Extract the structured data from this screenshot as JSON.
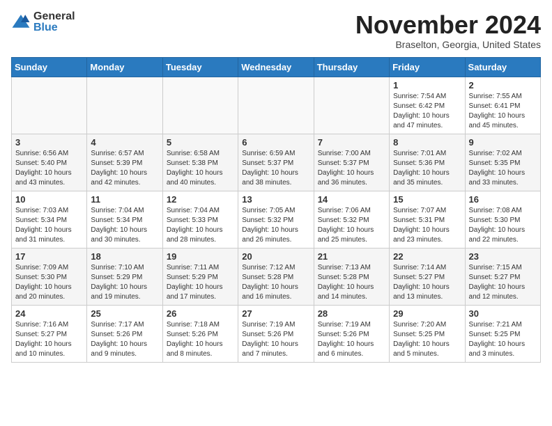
{
  "logo": {
    "general": "General",
    "blue": "Blue",
    "arrow_color": "#2a7abf"
  },
  "title": "November 2024",
  "location": "Braselton, Georgia, United States",
  "days_of_week": [
    "Sunday",
    "Monday",
    "Tuesday",
    "Wednesday",
    "Thursday",
    "Friday",
    "Saturday"
  ],
  "weeks": [
    [
      {
        "day": "",
        "info": ""
      },
      {
        "day": "",
        "info": ""
      },
      {
        "day": "",
        "info": ""
      },
      {
        "day": "",
        "info": ""
      },
      {
        "day": "",
        "info": ""
      },
      {
        "day": "1",
        "info": "Sunrise: 7:54 AM\nSunset: 6:42 PM\nDaylight: 10 hours and 47 minutes."
      },
      {
        "day": "2",
        "info": "Sunrise: 7:55 AM\nSunset: 6:41 PM\nDaylight: 10 hours and 45 minutes."
      }
    ],
    [
      {
        "day": "3",
        "info": "Sunrise: 6:56 AM\nSunset: 5:40 PM\nDaylight: 10 hours and 43 minutes."
      },
      {
        "day": "4",
        "info": "Sunrise: 6:57 AM\nSunset: 5:39 PM\nDaylight: 10 hours and 42 minutes."
      },
      {
        "day": "5",
        "info": "Sunrise: 6:58 AM\nSunset: 5:38 PM\nDaylight: 10 hours and 40 minutes."
      },
      {
        "day": "6",
        "info": "Sunrise: 6:59 AM\nSunset: 5:37 PM\nDaylight: 10 hours and 38 minutes."
      },
      {
        "day": "7",
        "info": "Sunrise: 7:00 AM\nSunset: 5:37 PM\nDaylight: 10 hours and 36 minutes."
      },
      {
        "day": "8",
        "info": "Sunrise: 7:01 AM\nSunset: 5:36 PM\nDaylight: 10 hours and 35 minutes."
      },
      {
        "day": "9",
        "info": "Sunrise: 7:02 AM\nSunset: 5:35 PM\nDaylight: 10 hours and 33 minutes."
      }
    ],
    [
      {
        "day": "10",
        "info": "Sunrise: 7:03 AM\nSunset: 5:34 PM\nDaylight: 10 hours and 31 minutes."
      },
      {
        "day": "11",
        "info": "Sunrise: 7:04 AM\nSunset: 5:34 PM\nDaylight: 10 hours and 30 minutes."
      },
      {
        "day": "12",
        "info": "Sunrise: 7:04 AM\nSunset: 5:33 PM\nDaylight: 10 hours and 28 minutes."
      },
      {
        "day": "13",
        "info": "Sunrise: 7:05 AM\nSunset: 5:32 PM\nDaylight: 10 hours and 26 minutes."
      },
      {
        "day": "14",
        "info": "Sunrise: 7:06 AM\nSunset: 5:32 PM\nDaylight: 10 hours and 25 minutes."
      },
      {
        "day": "15",
        "info": "Sunrise: 7:07 AM\nSunset: 5:31 PM\nDaylight: 10 hours and 23 minutes."
      },
      {
        "day": "16",
        "info": "Sunrise: 7:08 AM\nSunset: 5:30 PM\nDaylight: 10 hours and 22 minutes."
      }
    ],
    [
      {
        "day": "17",
        "info": "Sunrise: 7:09 AM\nSunset: 5:30 PM\nDaylight: 10 hours and 20 minutes."
      },
      {
        "day": "18",
        "info": "Sunrise: 7:10 AM\nSunset: 5:29 PM\nDaylight: 10 hours and 19 minutes."
      },
      {
        "day": "19",
        "info": "Sunrise: 7:11 AM\nSunset: 5:29 PM\nDaylight: 10 hours and 17 minutes."
      },
      {
        "day": "20",
        "info": "Sunrise: 7:12 AM\nSunset: 5:28 PM\nDaylight: 10 hours and 16 minutes."
      },
      {
        "day": "21",
        "info": "Sunrise: 7:13 AM\nSunset: 5:28 PM\nDaylight: 10 hours and 14 minutes."
      },
      {
        "day": "22",
        "info": "Sunrise: 7:14 AM\nSunset: 5:27 PM\nDaylight: 10 hours and 13 minutes."
      },
      {
        "day": "23",
        "info": "Sunrise: 7:15 AM\nSunset: 5:27 PM\nDaylight: 10 hours and 12 minutes."
      }
    ],
    [
      {
        "day": "24",
        "info": "Sunrise: 7:16 AM\nSunset: 5:27 PM\nDaylight: 10 hours and 10 minutes."
      },
      {
        "day": "25",
        "info": "Sunrise: 7:17 AM\nSunset: 5:26 PM\nDaylight: 10 hours and 9 minutes."
      },
      {
        "day": "26",
        "info": "Sunrise: 7:18 AM\nSunset: 5:26 PM\nDaylight: 10 hours and 8 minutes."
      },
      {
        "day": "27",
        "info": "Sunrise: 7:19 AM\nSunset: 5:26 PM\nDaylight: 10 hours and 7 minutes."
      },
      {
        "day": "28",
        "info": "Sunrise: 7:19 AM\nSunset: 5:26 PM\nDaylight: 10 hours and 6 minutes."
      },
      {
        "day": "29",
        "info": "Sunrise: 7:20 AM\nSunset: 5:25 PM\nDaylight: 10 hours and 5 minutes."
      },
      {
        "day": "30",
        "info": "Sunrise: 7:21 AM\nSunset: 5:25 PM\nDaylight: 10 hours and 3 minutes."
      }
    ]
  ]
}
